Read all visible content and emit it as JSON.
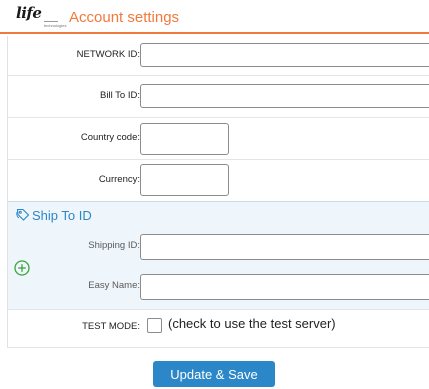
{
  "header": {
    "logo_text": "life",
    "logo_subtext": "technologies",
    "title": "Account settings"
  },
  "form": {
    "network_id": {
      "label": "NETWORK ID:",
      "value": ""
    },
    "bill_to_id": {
      "label": "Bill To ID:",
      "value": ""
    },
    "country_code": {
      "label": "Country code:",
      "value": ""
    },
    "currency": {
      "label": "Currency:",
      "value": ""
    }
  },
  "ship_to": {
    "title": "Ship To ID",
    "shipping_id": {
      "label": "Shipping ID:",
      "value": ""
    },
    "easy_name": {
      "label": "Easy Name:",
      "value": ""
    }
  },
  "test_mode": {
    "label": "TEST MODE:",
    "checked": false,
    "note": "(check to use the test server)"
  },
  "actions": {
    "update_save_label": "Update & Save"
  },
  "colors": {
    "accent_orange": "#f07a3c",
    "accent_blue": "#2b87c8",
    "ship_bg": "#eef5fb",
    "add_green": "#3aa53a"
  },
  "icons": {
    "ship_title": "tag-icon",
    "add": "plus-circle-icon"
  }
}
